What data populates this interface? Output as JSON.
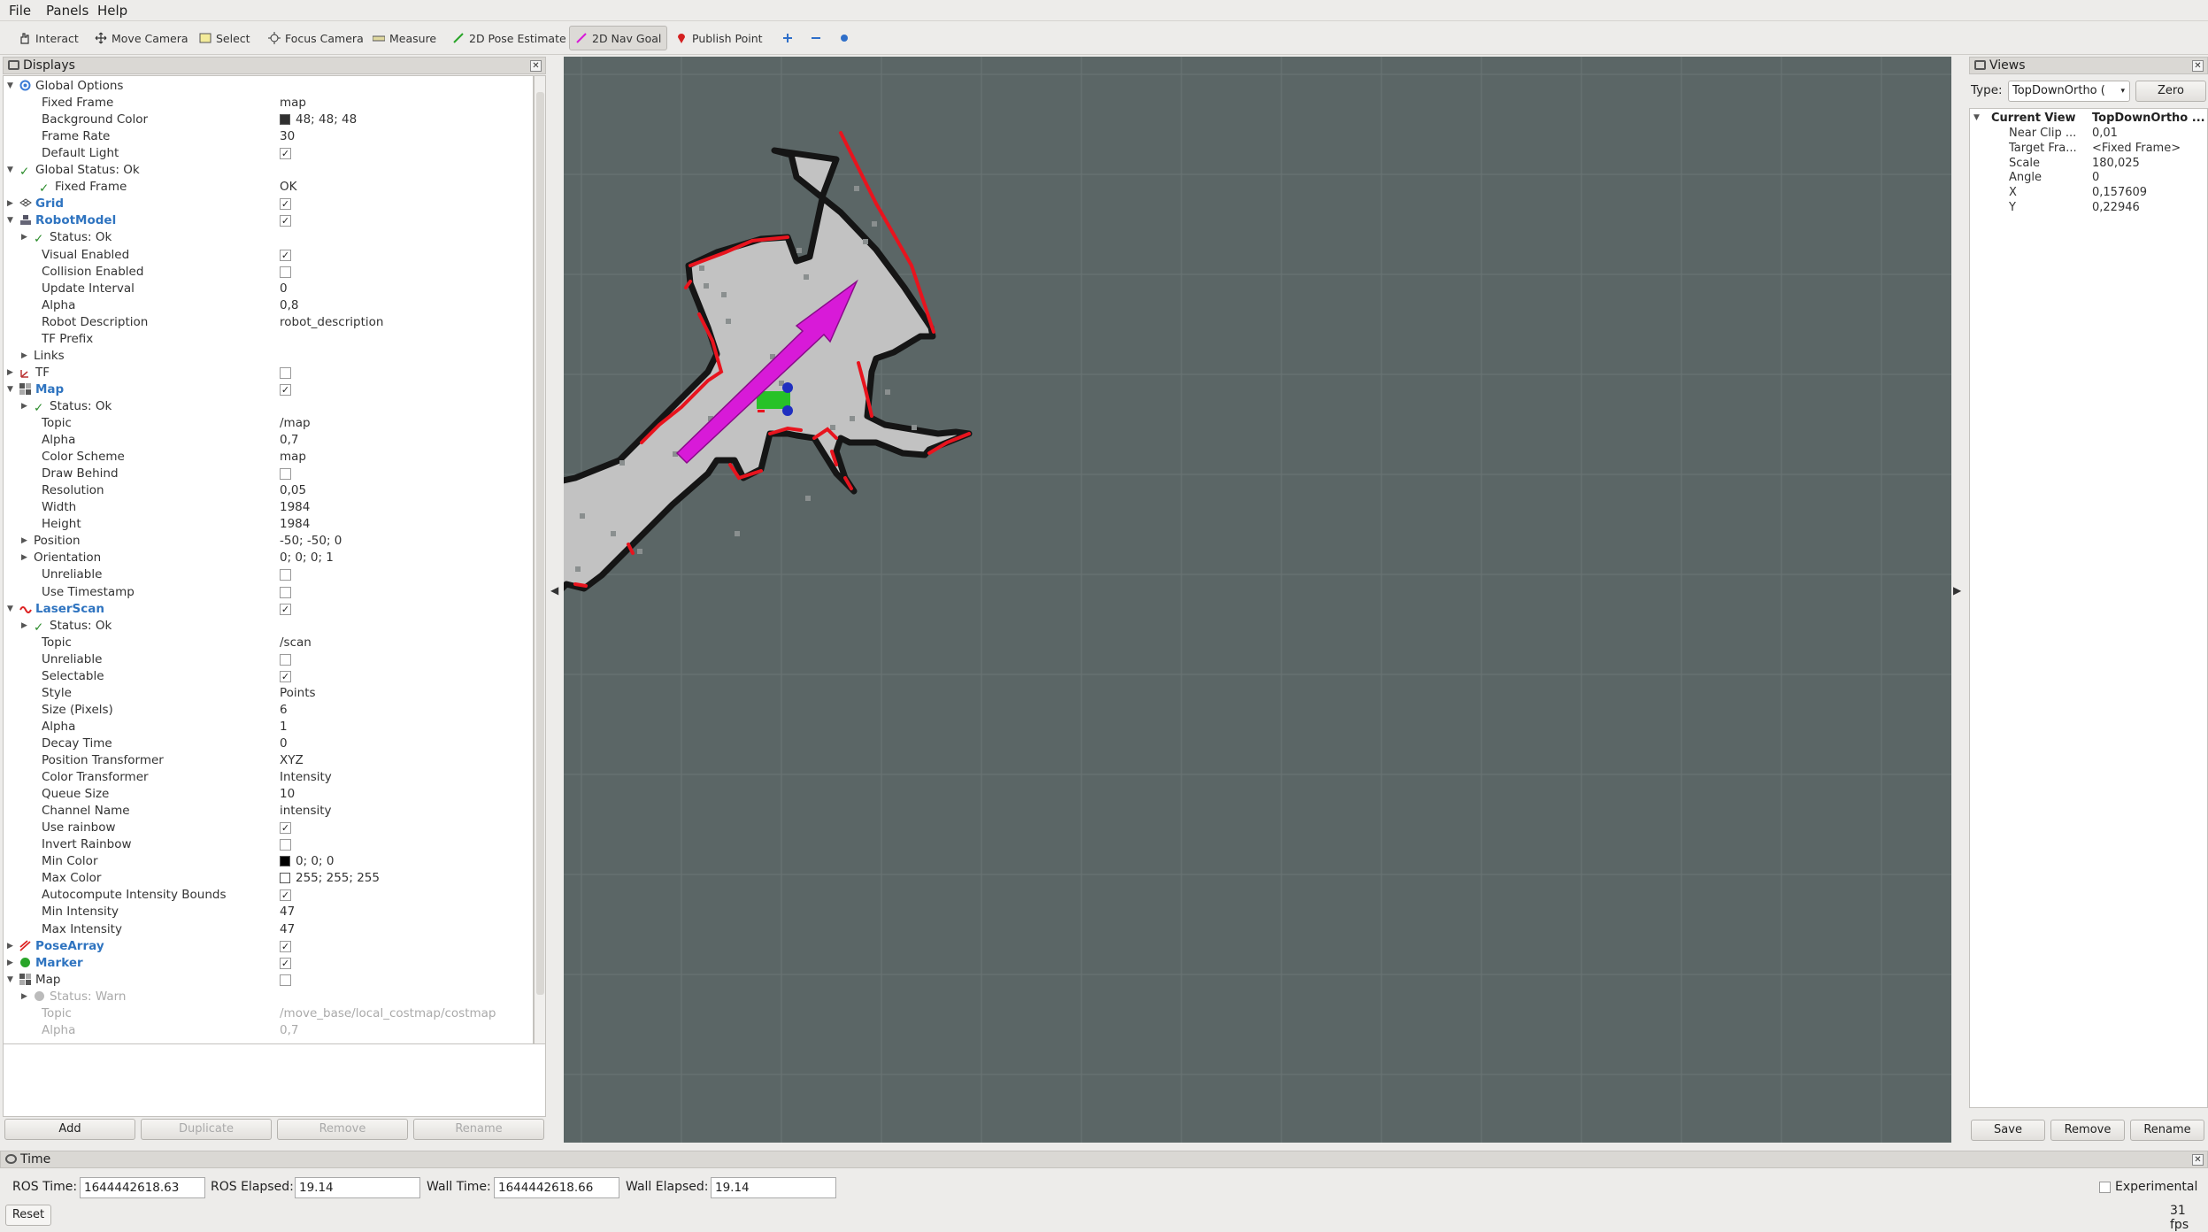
{
  "menu": [
    "File",
    "Panels",
    "Help"
  ],
  "toolbar": {
    "interact": "Interact",
    "move_camera": "Move Camera",
    "select": "Select",
    "focus_camera": "Focus Camera",
    "measure": "Measure",
    "pose_estimate": "2D Pose Estimate",
    "nav_goal": "2D Nav Goal",
    "publish_point": "Publish Point"
  },
  "displays": {
    "title": "Displays",
    "rows": [
      {
        "label": "Global Options",
        "value": ""
      },
      {
        "label": "Fixed Frame",
        "value": "map"
      },
      {
        "label": "Background Color",
        "value": "48; 48; 48"
      },
      {
        "label": "Frame Rate",
        "value": "30"
      },
      {
        "label": "Default Light",
        "value": ""
      },
      {
        "label": "Global Status: Ok",
        "value": ""
      },
      {
        "label": "Fixed Frame",
        "value": "OK"
      },
      {
        "label": "Grid",
        "value": ""
      },
      {
        "label": "RobotModel",
        "value": ""
      },
      {
        "label": "Status: Ok",
        "value": ""
      },
      {
        "label": "Visual Enabled",
        "value": ""
      },
      {
        "label": "Collision Enabled",
        "value": ""
      },
      {
        "label": "Update Interval",
        "value": "0"
      },
      {
        "label": "Alpha",
        "value": "0,8"
      },
      {
        "label": "Robot Description",
        "value": "robot_description"
      },
      {
        "label": "TF Prefix",
        "value": ""
      },
      {
        "label": "Links",
        "value": ""
      },
      {
        "label": "TF",
        "value": ""
      },
      {
        "label": "Map",
        "value": ""
      },
      {
        "label": "Status: Ok",
        "value": ""
      },
      {
        "label": "Topic",
        "value": "/map"
      },
      {
        "label": "Alpha",
        "value": "0,7"
      },
      {
        "label": "Color Scheme",
        "value": "map"
      },
      {
        "label": "Draw Behind",
        "value": ""
      },
      {
        "label": "Resolution",
        "value": "0,05"
      },
      {
        "label": "Width",
        "value": "1984"
      },
      {
        "label": "Height",
        "value": "1984"
      },
      {
        "label": "Position",
        "value": "-50; -50; 0"
      },
      {
        "label": "Orientation",
        "value": "0; 0; 0; 1"
      },
      {
        "label": "Unreliable",
        "value": ""
      },
      {
        "label": "Use Timestamp",
        "value": ""
      },
      {
        "label": "LaserScan",
        "value": ""
      },
      {
        "label": "Status: Ok",
        "value": ""
      },
      {
        "label": "Topic",
        "value": "/scan"
      },
      {
        "label": "Unreliable",
        "value": ""
      },
      {
        "label": "Selectable",
        "value": ""
      },
      {
        "label": "Style",
        "value": "Points"
      },
      {
        "label": "Size (Pixels)",
        "value": "6"
      },
      {
        "label": "Alpha",
        "value": "1"
      },
      {
        "label": "Decay Time",
        "value": "0"
      },
      {
        "label": "Position Transformer",
        "value": "XYZ"
      },
      {
        "label": "Color Transformer",
        "value": "Intensity"
      },
      {
        "label": "Queue Size",
        "value": "10"
      },
      {
        "label": "Channel Name",
        "value": "intensity"
      },
      {
        "label": "Use rainbow",
        "value": ""
      },
      {
        "label": "Invert Rainbow",
        "value": ""
      },
      {
        "label": "Min Color",
        "value": "0; 0; 0"
      },
      {
        "label": "Max Color",
        "value": "255; 255; 255"
      },
      {
        "label": "Autocompute Intensity Bounds",
        "value": ""
      },
      {
        "label": "Min Intensity",
        "value": "47"
      },
      {
        "label": "Max Intensity",
        "value": "47"
      },
      {
        "label": "PoseArray",
        "value": ""
      },
      {
        "label": "Marker",
        "value": ""
      },
      {
        "label": "Map",
        "value": ""
      },
      {
        "label": "Status: Warn",
        "value": ""
      },
      {
        "label": "Topic",
        "value": "/move_base/local_costmap/costmap"
      },
      {
        "label": "Alpha",
        "value": "0,7"
      }
    ],
    "buttons": {
      "add": "Add",
      "duplicate": "Duplicate",
      "remove": "Remove",
      "rename": "Rename"
    }
  },
  "views": {
    "title": "Views",
    "type_label": "Type:",
    "type_value": "TopDownOrtho (",
    "zero": "Zero",
    "current_view": "Current View",
    "current_view_type": "TopDownOrtho ...",
    "props": [
      {
        "key": "Near Clip ...",
        "value": "0,01"
      },
      {
        "key": "Target Fra...",
        "value": "<Fixed Frame>"
      },
      {
        "key": "Scale",
        "value": "180,025"
      },
      {
        "key": "Angle",
        "value": "0"
      },
      {
        "key": "X",
        "value": "0,157609"
      },
      {
        "key": "Y",
        "value": "0,22946"
      }
    ],
    "buttons": {
      "save": "Save",
      "remove": "Remove",
      "rename": "Rename"
    }
  },
  "time": {
    "title": "Time",
    "ros_time_label": "ROS Time:",
    "ros_time": "1644442618.63",
    "ros_elapsed_label": "ROS Elapsed:",
    "ros_elapsed": "19.14",
    "wall_time_label": "Wall Time:",
    "wall_time": "1644442618.66",
    "wall_elapsed_label": "Wall Elapsed:",
    "wall_elapsed": "19.14",
    "experimental": "Experimental",
    "reset": "Reset",
    "fps": "31 fps"
  },
  "colors": {
    "viewport_bg": "#5b6666",
    "map_free": "#c2c2c2",
    "map_wall": "#151515",
    "laser": "#e8141e",
    "goal_arrow": "#d81ad8",
    "robot": "#27c227",
    "wheels": "#1f2fc0"
  }
}
